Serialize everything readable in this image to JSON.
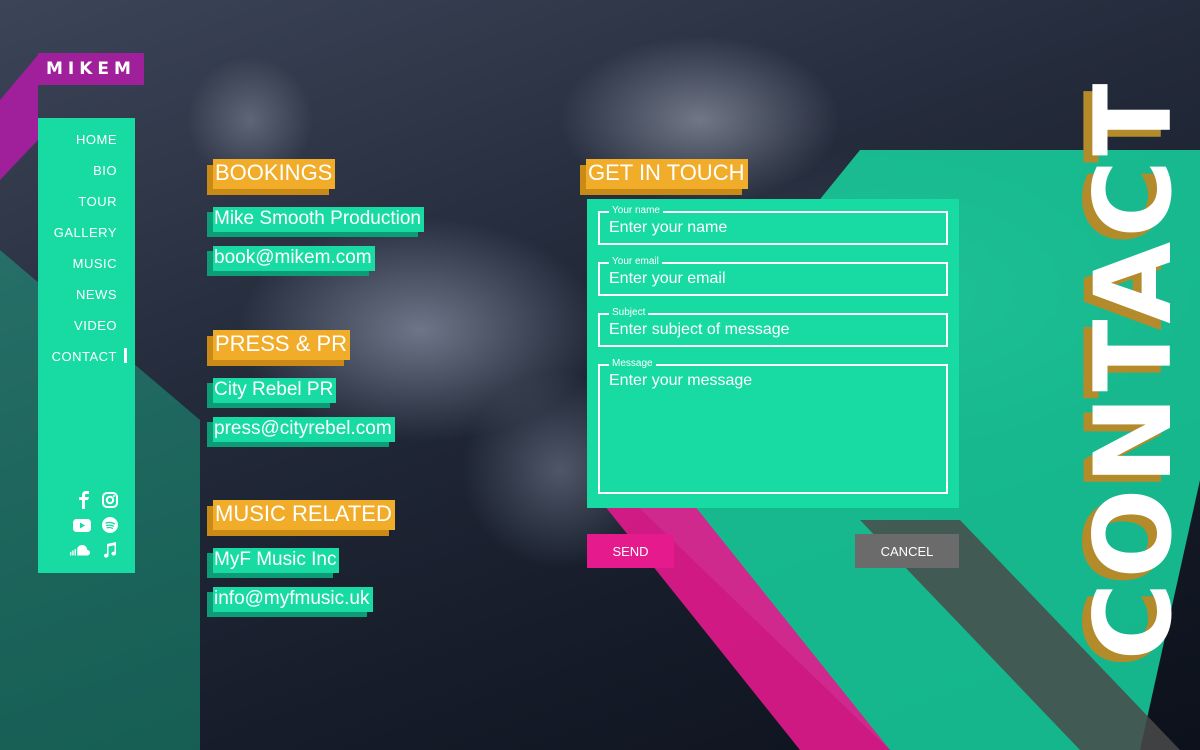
{
  "brand": {
    "logo_text": "MIKEM"
  },
  "nav": {
    "items": [
      {
        "label": "HOME"
      },
      {
        "label": "BIO"
      },
      {
        "label": "TOUR"
      },
      {
        "label": "GALLERY"
      },
      {
        "label": "MUSIC"
      },
      {
        "label": "NEWS"
      },
      {
        "label": "VIDEO"
      },
      {
        "label": "CONTACT",
        "active": true
      }
    ]
  },
  "socials": [
    "facebook-icon",
    "instagram-icon",
    "youtube-icon",
    "spotify-icon",
    "soundcloud-icon",
    "music-note-icon"
  ],
  "sections": [
    {
      "title": "BOOKINGS",
      "name": "Mike Smooth Production",
      "email": "book@mikem.com"
    },
    {
      "title": "PRESS & PR",
      "name": "City Rebel PR",
      "email": "press@cityrebel.com"
    },
    {
      "title": "MUSIC RELATED",
      "name": "MyF Music Inc",
      "email": "info@myfmusic.uk"
    }
  ],
  "form": {
    "title": "GET IN TOUCH",
    "name_label": "Your name",
    "name_placeholder": "Enter your name",
    "email_label": "Your email",
    "email_placeholder": "Enter your email",
    "subject_label": "Subject",
    "subject_placeholder": "Enter subject of message",
    "message_label": "Message",
    "message_placeholder": "Enter your message",
    "send_label": "SEND",
    "cancel_label": "CANCEL"
  },
  "page_heading": "CONTACT",
  "colors": {
    "accent_teal": "#17dba3",
    "accent_yellow": "#f1ac2a",
    "accent_magenta": "#e41a8d",
    "logo_purple": "#a01f9a",
    "cancel_gray": "#6b6b6b"
  }
}
